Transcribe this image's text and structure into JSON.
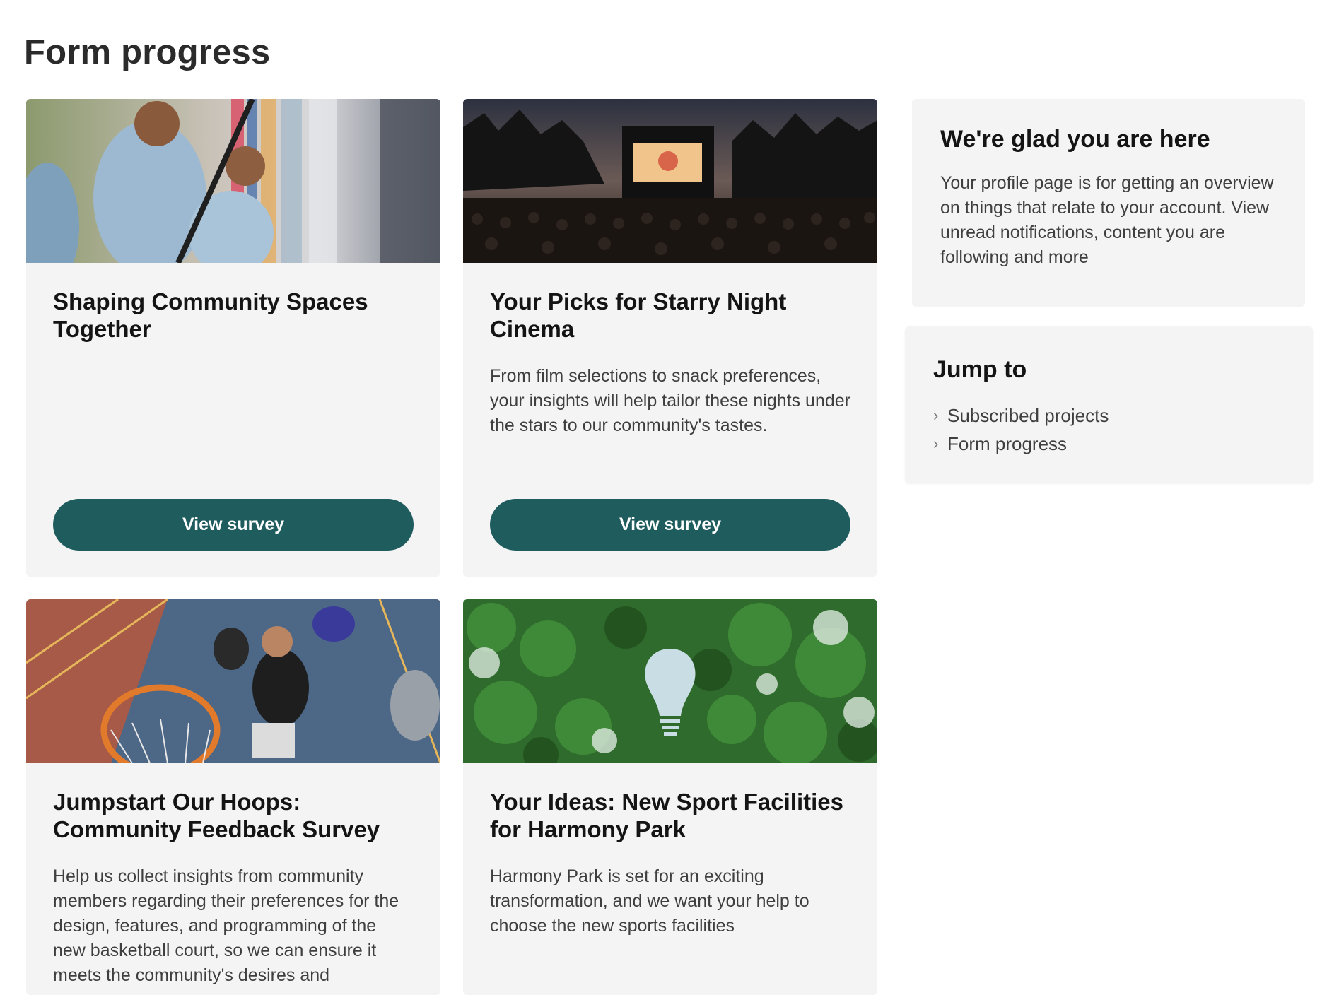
{
  "page": {
    "title": "Form progress"
  },
  "cards": [
    {
      "title": "Shaping Community Spaces Together",
      "description": "",
      "button_label": "View survey",
      "image": "mural-painting-photo"
    },
    {
      "title": "Your Picks for Starry Night Cinema",
      "description": "From film selections to snack preferences, your insights will help tailor these nights under the stars to our community's tastes.",
      "button_label": "View survey",
      "image": "outdoor-cinema-photo"
    },
    {
      "title": "Jumpstart Our Hoops: Community Feedback Survey",
      "description": "Help us collect insights from community members regarding their preferences for the design, features, and programming of the new basketball court, so we can ensure it meets the community's desires and",
      "image": "basketball-dunk-photo"
    },
    {
      "title": "Your Ideas: New Sport Facilities for Harmony Park",
      "description": "Harmony Park is set for an exciting transformation, and we want your help to choose the new sports facilities",
      "image": "forest-lightbulb-photo"
    }
  ],
  "welcome": {
    "title": "We're glad you are here",
    "text": "Your profile page is for getting an overview on things that relate to your account. View unread notifications, content you are following and more"
  },
  "jump_to": {
    "title": "Jump to",
    "items": [
      {
        "label": "Subscribed projects",
        "icon": "chevron-right-icon"
      },
      {
        "label": "Form progress",
        "icon": "chevron-right-icon"
      }
    ]
  },
  "colors": {
    "button": "#1f5c5e",
    "card_bg": "#f4f4f4"
  }
}
